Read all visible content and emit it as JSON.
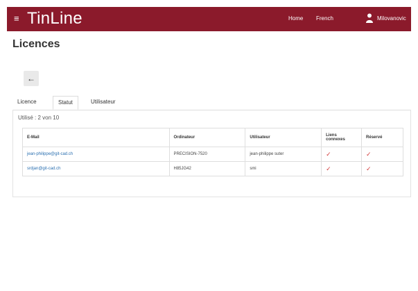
{
  "header": {
    "menu_icon": "hamburger-menu-icon",
    "brand": "TinLine",
    "nav_home": "Home",
    "nav_language": "French",
    "user_icon": "person-icon",
    "user_name": "Milovanovic",
    "bar_color": "#8b1a2b"
  },
  "page": {
    "title": "Licences",
    "back_icon": "arrow-left-icon"
  },
  "tabs": [
    {
      "label": "Licence",
      "active": false
    },
    {
      "label": "Statut",
      "active": true
    },
    {
      "label": "Utilisateur",
      "active": false
    }
  ],
  "status": {
    "usage_text": "Utilisé : 2 von 10",
    "columns": [
      "E-Mail",
      "Ordinateur",
      "Utilisateur",
      "Liens connexes",
      "Réservé"
    ],
    "rows": [
      {
        "email": "jean-philippe@git-cad.ch",
        "computer": "PRECISION-7520",
        "user": "jean-philippe suter",
        "linked": "✓",
        "reserved": "✓"
      },
      {
        "email": "srdjan@git-cad.ch",
        "computer": "H85JG42",
        "user": "smi",
        "linked": "✓",
        "reserved": "✓"
      }
    ],
    "check_color": "#d23b3b"
  }
}
